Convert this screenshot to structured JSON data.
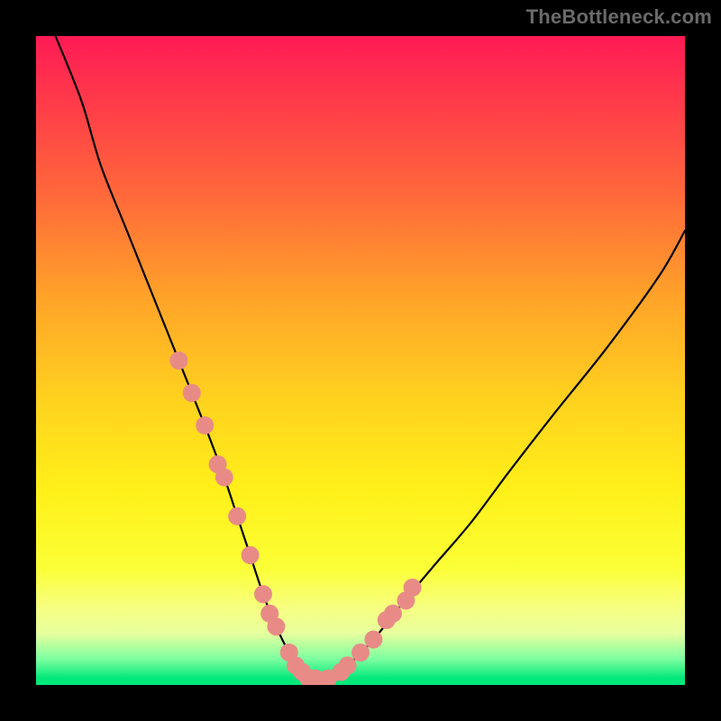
{
  "watermark": "TheBottleneck.com",
  "chart_data": {
    "type": "line",
    "title": "",
    "xlabel": "",
    "ylabel": "",
    "xlim": [
      0,
      100
    ],
    "ylim": [
      0,
      100
    ],
    "grid": false,
    "legend": false,
    "series": [
      {
        "name": "bottleneck-curve",
        "x": [
          3,
          7,
          10,
          14,
          18,
          22,
          26,
          29,
          31,
          33,
          35,
          37,
          39,
          41,
          43,
          45,
          48,
          52,
          56,
          61,
          67,
          73,
          80,
          88,
          96,
          100
        ],
        "y": [
          100,
          90,
          80,
          70,
          60,
          50,
          40,
          32,
          26,
          20,
          14,
          9,
          5,
          2,
          1,
          1,
          3,
          7,
          12,
          18,
          25,
          33,
          42,
          52,
          63,
          70
        ]
      }
    ],
    "markers": {
      "name": "highlight-dots",
      "color": "#e88b87",
      "radius": 10,
      "points": [
        {
          "x": 22,
          "y": 50
        },
        {
          "x": 24,
          "y": 45
        },
        {
          "x": 26,
          "y": 40
        },
        {
          "x": 28,
          "y": 34
        },
        {
          "x": 29,
          "y": 32
        },
        {
          "x": 31,
          "y": 26
        },
        {
          "x": 33,
          "y": 20
        },
        {
          "x": 35,
          "y": 14
        },
        {
          "x": 36,
          "y": 11
        },
        {
          "x": 37,
          "y": 9
        },
        {
          "x": 39,
          "y": 5
        },
        {
          "x": 40,
          "y": 3
        },
        {
          "x": 41,
          "y": 2
        },
        {
          "x": 42,
          "y": 1
        },
        {
          "x": 43,
          "y": 1
        },
        {
          "x": 45,
          "y": 1
        },
        {
          "x": 47,
          "y": 2
        },
        {
          "x": 48,
          "y": 3
        },
        {
          "x": 50,
          "y": 5
        },
        {
          "x": 52,
          "y": 7
        },
        {
          "x": 54,
          "y": 10
        },
        {
          "x": 55,
          "y": 11
        },
        {
          "x": 57,
          "y": 13
        },
        {
          "x": 58,
          "y": 15
        }
      ]
    },
    "background_gradient_stops": [
      {
        "pos": 0.0,
        "color": "#ff1a55"
      },
      {
        "pos": 0.25,
        "color": "#ff6a3a"
      },
      {
        "pos": 0.55,
        "color": "#ffcf1f"
      },
      {
        "pos": 0.82,
        "color": "#fbff36"
      },
      {
        "pos": 0.96,
        "color": "#7dffa0"
      },
      {
        "pos": 1.0,
        "color": "#00e87a"
      }
    ]
  }
}
